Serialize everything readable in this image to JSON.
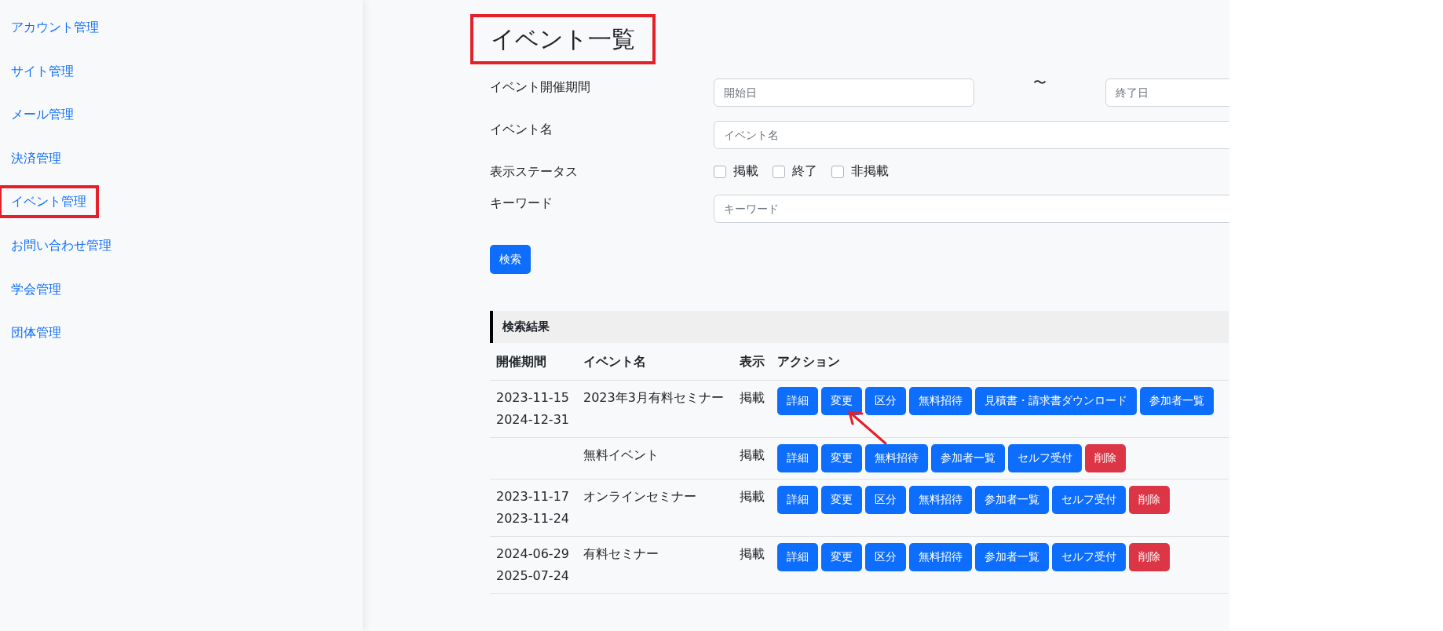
{
  "sidebar": {
    "items": [
      {
        "label": "アカウント管理",
        "highlighted": false
      },
      {
        "label": "サイト管理",
        "highlighted": false
      },
      {
        "label": "メール管理",
        "highlighted": false
      },
      {
        "label": "決済管理",
        "highlighted": false
      },
      {
        "label": "イベント管理",
        "highlighted": true
      },
      {
        "label": "お問い合わせ管理",
        "highlighted": false
      },
      {
        "label": "学会管理",
        "highlighted": false
      },
      {
        "label": "団体管理",
        "highlighted": false
      }
    ]
  },
  "page_title": {
    "text": "イベント一覧",
    "highlighted": true
  },
  "search_form": {
    "period": {
      "label": "イベント開催期間",
      "start_placeholder": "開始日",
      "separator": "〜",
      "end_placeholder": "終了日"
    },
    "event_name": {
      "label": "イベント名",
      "placeholder": "イベント名"
    },
    "status": {
      "label": "表示ステータス",
      "options": [
        {
          "label": "掲載",
          "checked": false
        },
        {
          "label": "終了",
          "checked": false
        },
        {
          "label": "非掲載",
          "checked": false
        }
      ]
    },
    "keyword": {
      "label": "キーワード",
      "placeholder": "キーワード"
    },
    "search_button": "検索"
  },
  "results": {
    "heading": "検索結果",
    "columns": [
      "開催期間",
      "イベント名",
      "表示",
      "アクション"
    ],
    "rows": [
      {
        "start": "2023-11-15",
        "end": "2024-12-31",
        "name": "2023年3月有料セミナー",
        "display": "掲載",
        "actions": [
          {
            "label": "詳細",
            "kind": "primary",
            "pointed": false
          },
          {
            "label": "変更",
            "kind": "primary",
            "pointed": true
          },
          {
            "label": "区分",
            "kind": "primary",
            "pointed": false
          },
          {
            "label": "無料招待",
            "kind": "primary",
            "pointed": false
          },
          {
            "label": "見積書・請求書ダウンロード",
            "kind": "primary",
            "pointed": false
          },
          {
            "label": "参加者一覧",
            "kind": "primary",
            "pointed": false
          }
        ]
      },
      {
        "start": "",
        "end": "",
        "name": "無料イベント",
        "display": "掲載",
        "actions": [
          {
            "label": "詳細",
            "kind": "primary",
            "pointed": false
          },
          {
            "label": "変更",
            "kind": "primary",
            "pointed": false
          },
          {
            "label": "無料招待",
            "kind": "primary",
            "pointed": false
          },
          {
            "label": "参加者一覧",
            "kind": "primary",
            "pointed": false
          },
          {
            "label": "セルフ受付",
            "kind": "primary",
            "pointed": false
          },
          {
            "label": "削除",
            "kind": "danger",
            "pointed": false
          }
        ]
      },
      {
        "start": "2023-11-17",
        "end": "2023-11-24",
        "name": "オンラインセミナー",
        "display": "掲載",
        "actions": [
          {
            "label": "詳細",
            "kind": "primary",
            "pointed": false
          },
          {
            "label": "変更",
            "kind": "primary",
            "pointed": false
          },
          {
            "label": "区分",
            "kind": "primary",
            "pointed": false
          },
          {
            "label": "無料招待",
            "kind": "primary",
            "pointed": false
          },
          {
            "label": "参加者一覧",
            "kind": "primary",
            "pointed": false
          },
          {
            "label": "セルフ受付",
            "kind": "primary",
            "pointed": false
          },
          {
            "label": "削除",
            "kind": "danger",
            "pointed": false
          }
        ]
      },
      {
        "start": "2024-06-29",
        "end": "2025-07-24",
        "name": "有料セミナー",
        "display": "掲載",
        "actions": [
          {
            "label": "詳細",
            "kind": "primary",
            "pointed": false
          },
          {
            "label": "変更",
            "kind": "primary",
            "pointed": false
          },
          {
            "label": "区分",
            "kind": "primary",
            "pointed": false
          },
          {
            "label": "無料招待",
            "kind": "primary",
            "pointed": false
          },
          {
            "label": "参加者一覧",
            "kind": "primary",
            "pointed": false
          },
          {
            "label": "セルフ受付",
            "kind": "primary",
            "pointed": false
          },
          {
            "label": "削除",
            "kind": "danger",
            "pointed": false
          }
        ]
      }
    ]
  }
}
